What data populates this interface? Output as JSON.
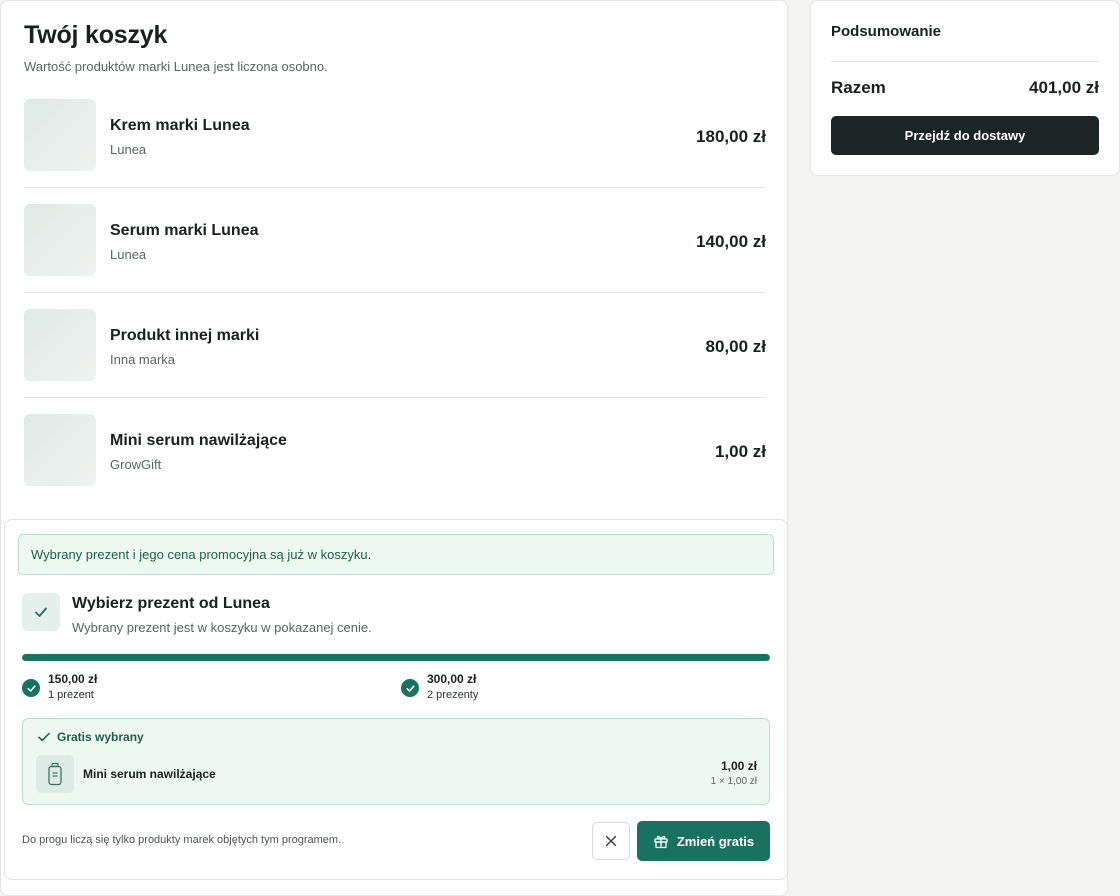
{
  "cart": {
    "title": "Twój koszyk",
    "subtitle": "Wartość produktów marki Lunea jest liczona osobno.",
    "items": [
      {
        "name": "Krem marki Lunea",
        "brand": "Lunea",
        "price": "180,00 zł"
      },
      {
        "name": "Serum marki Lunea",
        "brand": "Lunea",
        "price": "140,00 zł"
      },
      {
        "name": "Produkt innej marki",
        "brand": "Inna marka",
        "price": "80,00 zł"
      },
      {
        "name": "Mini serum nawilżające",
        "brand": "GrowGift",
        "price": "1,00 zł"
      }
    ]
  },
  "gift": {
    "notice": "Wybrany prezent i jego cena promocyjna są już w koszyku.",
    "title": "Wybierz prezent od Lunea",
    "subtitle": "Wybrany prezent jest w koszyku w pokazanej cenie.",
    "progress_fraction": 1.0,
    "thresholds": [
      {
        "amount": "150,00 zł",
        "label": "1 prezent",
        "reached": true
      },
      {
        "amount": "300,00 zł",
        "label": "2 prezenty",
        "reached": true
      }
    ],
    "selected": {
      "header": "Gratis wybrany",
      "name": "Mini serum nawilżające",
      "price": "1,00 zł",
      "qty": "1 × 1,00 zł"
    },
    "footnote": "Do progu liczą się tylko produkty marek objętych tym programem.",
    "change_label": "Zmień gratis"
  },
  "summary": {
    "title": "Podsumowanie",
    "total_label": "Razem",
    "total_value": "401,00 zł",
    "checkout_label": "Przejdź do dostawy"
  },
  "colors": {
    "accent": "#18725f",
    "dark_button": "#1b2523",
    "notice_bg": "#eef8f3"
  },
  "icons": {
    "check": "check-icon",
    "close": "close-icon",
    "gift": "gift-icon",
    "bottle": "bottle-icon"
  }
}
